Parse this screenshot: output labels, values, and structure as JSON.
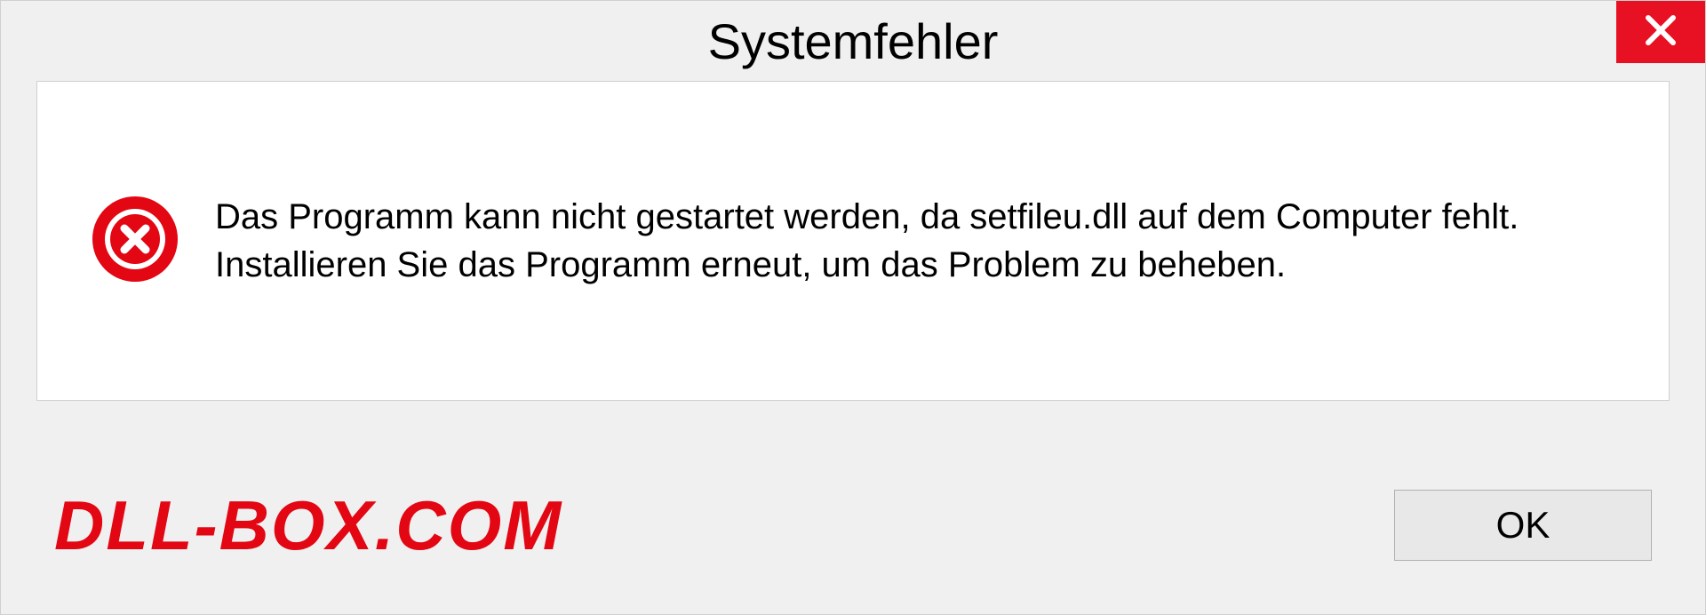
{
  "dialog": {
    "title": "Systemfehler",
    "message": "Das Programm kann nicht gestartet werden, da setfileu.dll auf dem Computer fehlt. Installieren Sie das Programm erneut, um das Problem zu beheben.",
    "ok_label": "OK"
  },
  "watermark": {
    "text": "DLL-BOX.COM"
  },
  "colors": {
    "close_button": "#e81123",
    "error_icon": "#e30613",
    "watermark": "#e30613"
  }
}
